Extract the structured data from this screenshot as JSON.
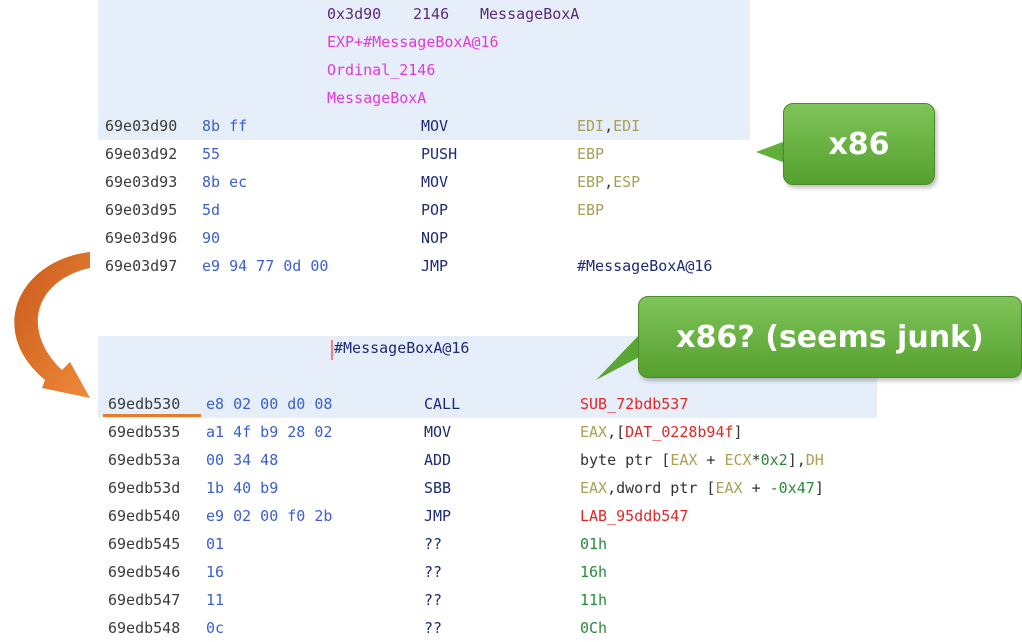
{
  "block1": {
    "header": {
      "address": "0x3d90",
      "ordinal": "2146",
      "name": "MessageBoxA",
      "labels": [
        "EXP+#MessageBoxA@16",
        "Ordinal_2146",
        "MessageBoxA"
      ]
    },
    "rows": [
      {
        "addr": "69e03d90",
        "bytes": "8b ff",
        "mnem": "MOV",
        "ops": [
          {
            "t": "EDI",
            "c": "reg"
          },
          {
            "t": ",",
            "c": "blk"
          },
          {
            "t": "EDI",
            "c": "reg"
          }
        ]
      },
      {
        "addr": "69e03d92",
        "bytes": "55",
        "mnem": "PUSH",
        "ops": [
          {
            "t": "EBP",
            "c": "reg"
          }
        ]
      },
      {
        "addr": "69e03d93",
        "bytes": "8b ec",
        "mnem": "MOV",
        "ops": [
          {
            "t": "EBP",
            "c": "reg"
          },
          {
            "t": ",",
            "c": "blk"
          },
          {
            "t": "ESP",
            "c": "reg"
          }
        ]
      },
      {
        "addr": "69e03d95",
        "bytes": "5d",
        "mnem": "POP",
        "ops": [
          {
            "t": "EBP",
            "c": "reg"
          }
        ]
      },
      {
        "addr": "69e03d96",
        "bytes": "90",
        "mnem": "NOP",
        "ops": []
      },
      {
        "addr": "69e03d97",
        "bytes": "e9 94 77 0d 00",
        "mnem": "JMP",
        "ops": [
          {
            "t": "#MessageBoxA@16",
            "c": "sym"
          }
        ]
      }
    ]
  },
  "block2": {
    "label": "#MessageBoxA@16",
    "rows": [
      {
        "addr": "69edb530",
        "bytes": "e8 02 00 d0 08",
        "mnem": "CALL",
        "ops": [
          {
            "t": "SUB_72bdb537",
            "c": "red"
          }
        ]
      },
      {
        "addr": "69edb535",
        "bytes": "a1 4f b9 28 02",
        "mnem": "MOV",
        "ops": [
          {
            "t": "EAX",
            "c": "reg"
          },
          {
            "t": ",[",
            "c": "blk"
          },
          {
            "t": "DAT_0228b94f",
            "c": "red"
          },
          {
            "t": "]",
            "c": "blk"
          }
        ]
      },
      {
        "addr": "69edb53a",
        "bytes": "00 34 48",
        "mnem": "ADD",
        "ops": [
          {
            "t": "byte ptr [",
            "c": "blk"
          },
          {
            "t": "EAX",
            "c": "reg"
          },
          {
            "t": " + ",
            "c": "blk"
          },
          {
            "t": "ECX",
            "c": "reg"
          },
          {
            "t": "*",
            "c": "blk"
          },
          {
            "t": "0x2",
            "c": "grn"
          },
          {
            "t": "],",
            "c": "blk"
          },
          {
            "t": "DH",
            "c": "reg"
          }
        ]
      },
      {
        "addr": "69edb53d",
        "bytes": "1b 40 b9",
        "mnem": "SBB",
        "ops": [
          {
            "t": "EAX",
            "c": "reg"
          },
          {
            "t": ",dword ptr [",
            "c": "blk"
          },
          {
            "t": "EAX",
            "c": "reg"
          },
          {
            "t": " + ",
            "c": "blk"
          },
          {
            "t": "-0x47",
            "c": "grn"
          },
          {
            "t": "]",
            "c": "blk"
          }
        ]
      },
      {
        "addr": "69edb540",
        "bytes": "e9 02 00 f0 2b",
        "mnem": "JMP",
        "ops": [
          {
            "t": "LAB_95ddb547",
            "c": "red"
          }
        ]
      },
      {
        "addr": "69edb545",
        "bytes": "01",
        "mnem": "??",
        "ops": [
          {
            "t": "01h",
            "c": "grn"
          }
        ]
      },
      {
        "addr": "69edb546",
        "bytes": "16",
        "mnem": "??",
        "ops": [
          {
            "t": "16h",
            "c": "grn"
          }
        ]
      },
      {
        "addr": "69edb547",
        "bytes": "11",
        "mnem": "??",
        "ops": [
          {
            "t": "11h",
            "c": "grn"
          }
        ]
      },
      {
        "addr": "69edb548",
        "bytes": "0c",
        "mnem": "??",
        "ops": [
          {
            "t": "0Ch",
            "c": "grn"
          }
        ]
      }
    ]
  },
  "callouts": {
    "top": "x86",
    "bottom": "x86? (seems junk)"
  },
  "colors": {
    "callout_green": "#6db544",
    "arrow_orange": "#e87a2a",
    "highlight": "#e6eef9"
  }
}
